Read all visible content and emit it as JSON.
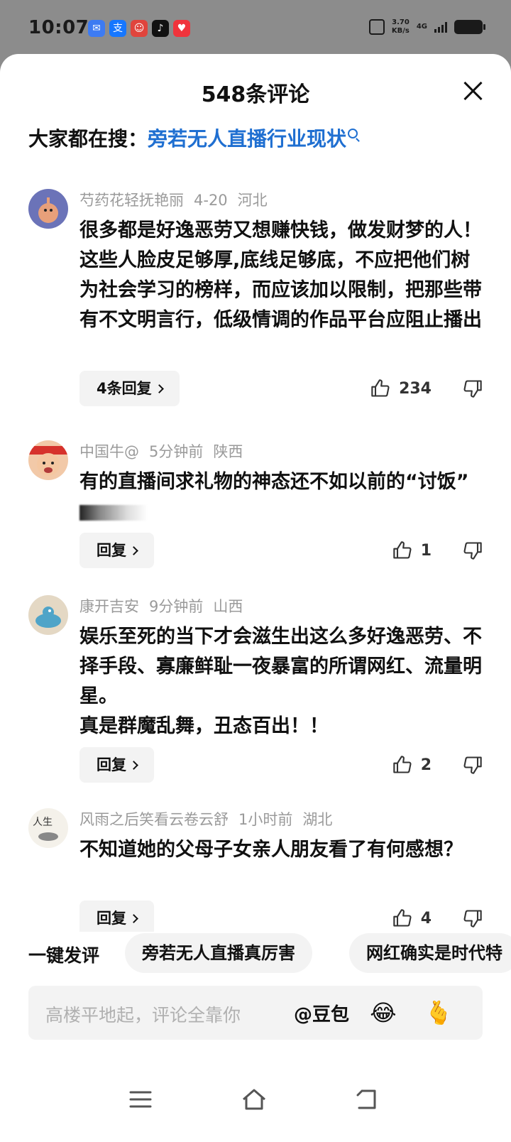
{
  "status_bar": {
    "time": "10:07",
    "speed_value": "3.70",
    "speed_unit": "KB/s",
    "network": "4G"
  },
  "header": {
    "title": "548条评论"
  },
  "search": {
    "prefix": "大家都在搜：",
    "query": "旁若无人直播行业现状"
  },
  "comments": [
    {
      "user": "芍药花轻抚艳丽",
      "time": "4-20",
      "location": "河北",
      "text": "很多都是好逸恶劳又想赚快钱，做发财梦的人！这些人脸皮足够厚,底线足够底，不应把他们树为社会学习的榜样，而应该加以限制，把那些带有不文明言行，低级情调的作品平台应阻止播出",
      "reply_label": "4条回复",
      "likes": "234"
    },
    {
      "user": "中国牛@",
      "time": "5分钟前",
      "location": "陕西",
      "text": "有的直播间求礼物的神态还不如以前的“讨饭”",
      "reply_label": "回复",
      "likes": "1"
    },
    {
      "user": "康开吉安",
      "time": "9分钟前",
      "location": "山西",
      "text": "娱乐至死的当下才会滋生出这么多好逸恶劳、不择手段、寡廉鲜耻一夜暴富的所谓网红、流量明星。",
      "text2": "真是群魔乱舞，丑态百出！！",
      "reply_label": "回复",
      "likes": "2"
    },
    {
      "user": "风雨之后笑看云卷云舒",
      "time": "1小时前",
      "location": "湖北",
      "text": "不知道她的父母子女亲人朋友看了有何感想？",
      "reply_label": "回复",
      "likes": "4"
    }
  ],
  "quick_comment": {
    "label": "一键发评",
    "chips": [
      "旁若无人直播真厉害",
      "网红确实是时代特"
    ]
  },
  "input": {
    "placeholder": "高楼平地起，评论全靠你",
    "mention": "@豆包"
  },
  "icons": {
    "emoji_laugh": "laughing-face-icon",
    "emoji_heart": "finger-heart-icon"
  },
  "colors": {
    "accent": "#1f6fd1",
    "status_bg": "#8c8c8c"
  }
}
